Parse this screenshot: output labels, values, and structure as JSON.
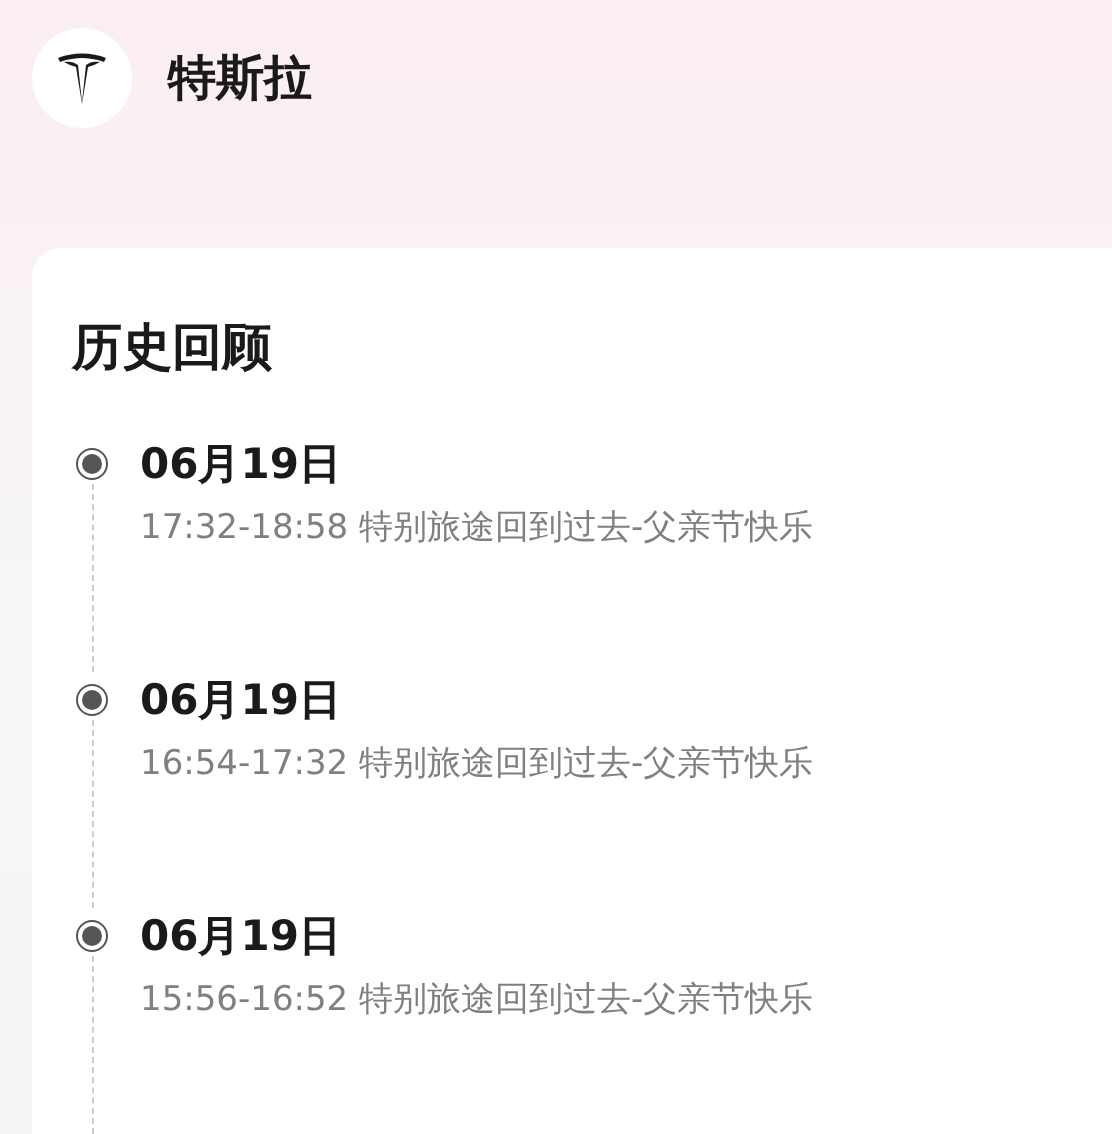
{
  "header": {
    "title": "特斯拉"
  },
  "card": {
    "title": "历史回顾",
    "entries": [
      {
        "date": "06月19日",
        "detail": "17:32-18:58 特别旅途回到过去-父亲节快乐"
      },
      {
        "date": "06月19日",
        "detail": "16:54-17:32 特别旅途回到过去-父亲节快乐"
      },
      {
        "date": "06月19日",
        "detail": "15:56-16:52 特别旅途回到过去-父亲节快乐"
      }
    ]
  }
}
